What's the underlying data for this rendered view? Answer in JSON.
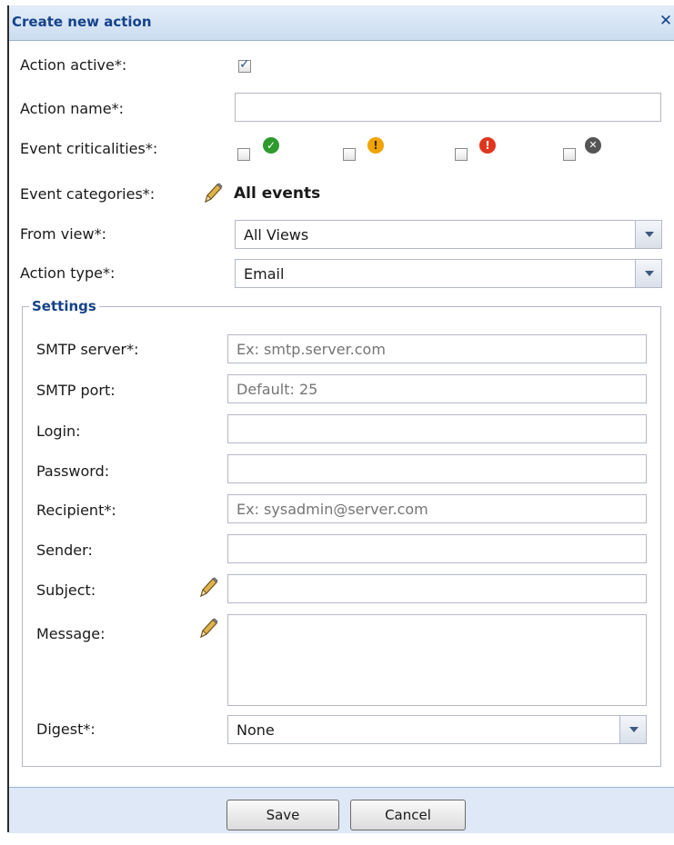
{
  "dialog": {
    "title": "Create new action",
    "close_symbol": "✕"
  },
  "form": {
    "action_active_label": "Action active*:",
    "action_active_checked": true,
    "action_name_label": "Action name*:",
    "action_name_value": "",
    "event_criticalities_label": "Event criticalities*:",
    "criticalities": [
      {
        "icon": "ok-check-icon",
        "color": "#2e9a2e",
        "checked": false
      },
      {
        "icon": "warning-icon",
        "color": "#f0a400",
        "checked": false
      },
      {
        "icon": "error-icon",
        "color": "#e0361d",
        "checked": false
      },
      {
        "icon": "unknown-x-icon",
        "color": "#555555",
        "checked": false
      }
    ],
    "event_categories_label": "Event categories*:",
    "event_categories_value": "All events",
    "from_view_label": "From view*:",
    "from_view_value": "All Views",
    "action_type_label": "Action type*:",
    "action_type_value": "Email"
  },
  "settings": {
    "legend": "Settings",
    "smtp_server_label": "SMTP server*:",
    "smtp_server_placeholder": "Ex: smtp.server.com",
    "smtp_port_label": "SMTP port:",
    "smtp_port_placeholder": "Default: 25",
    "login_label": "Login:",
    "password_label": "Password:",
    "recipient_label": "Recipient*:",
    "recipient_placeholder": "Ex: sysadmin@server.com",
    "sender_label": "Sender:",
    "subject_label": "Subject:",
    "message_label": "Message:",
    "digest_label": "Digest*:",
    "digest_value": "None"
  },
  "footer": {
    "save_label": "Save",
    "cancel_label": "Cancel"
  },
  "colors": {
    "title_text": "#15428b",
    "title_bg": "#cbdcf0",
    "footer_bg": "#dfe8f6"
  }
}
